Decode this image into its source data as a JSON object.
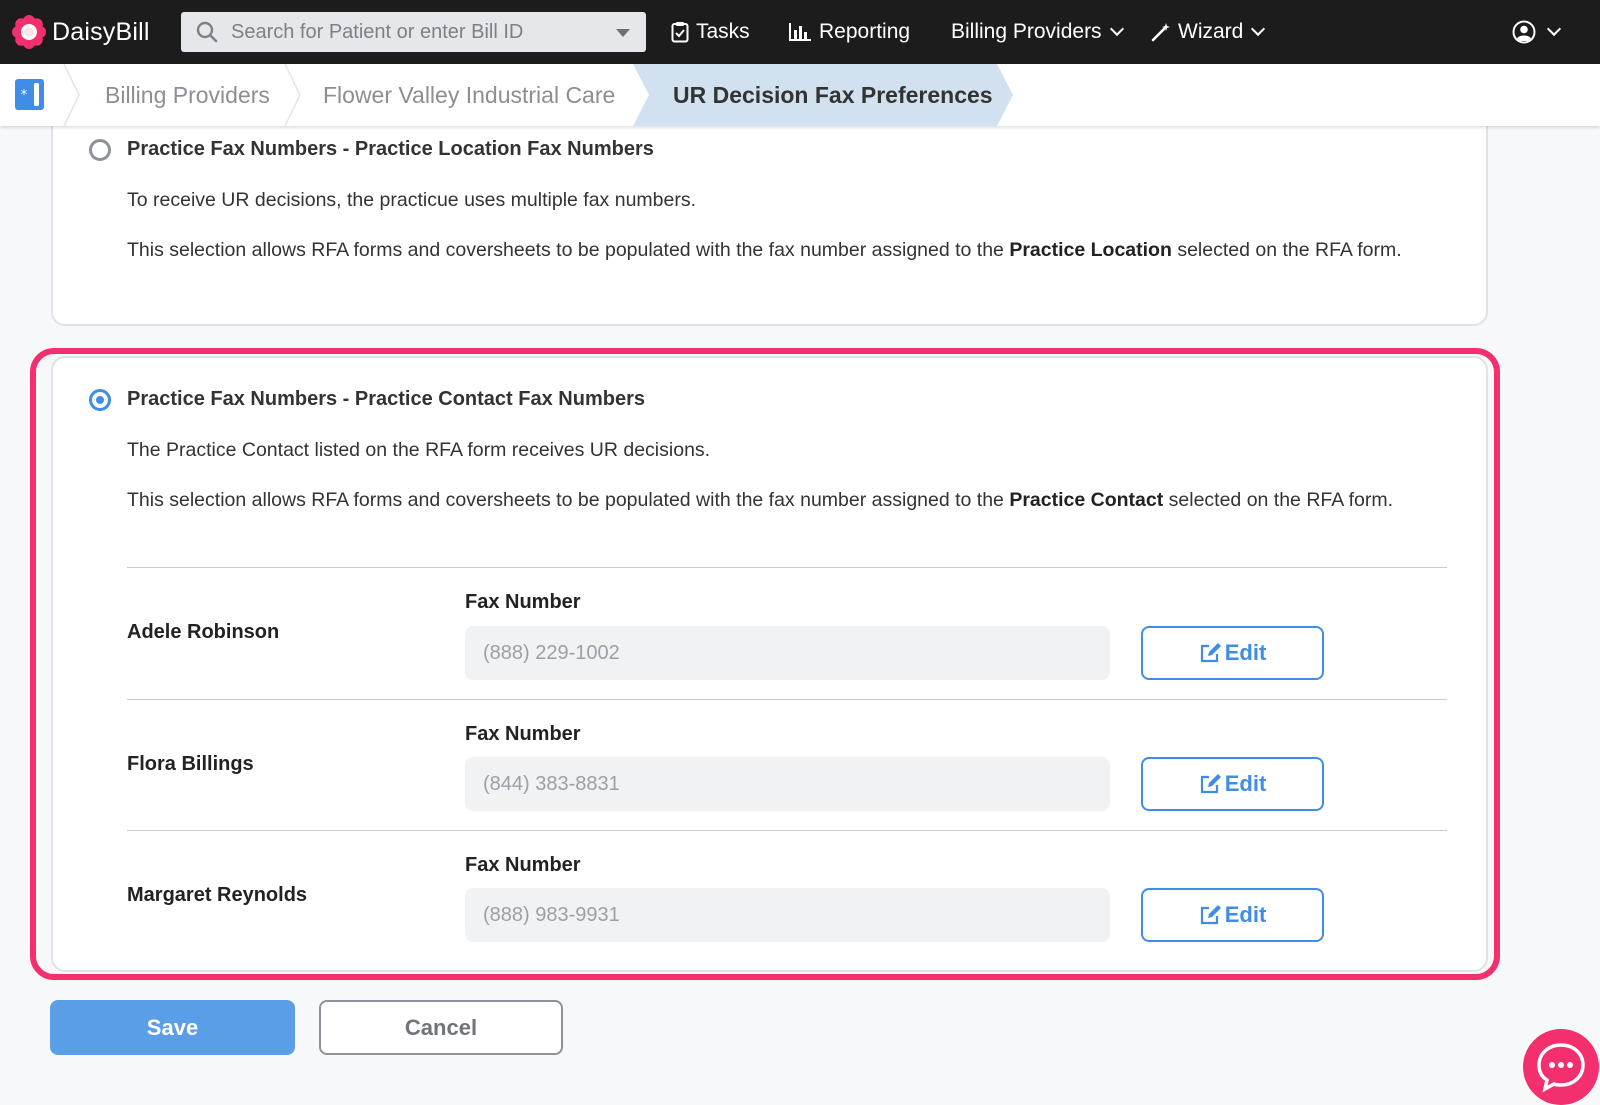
{
  "app": {
    "name": "DaisyBill"
  },
  "colors": {
    "accent": "#3f8de8",
    "highlight": "#f42f6d",
    "navbar": "#1c1c1c"
  },
  "navbar": {
    "search_placeholder": "Search for Patient or enter Bill ID",
    "items": [
      {
        "label": "Tasks",
        "icon": "clipboard-check-icon"
      },
      {
        "label": "Reporting",
        "icon": "bar-chart-icon"
      },
      {
        "label": "Billing Providers",
        "icon": "chevron-down-icon"
      },
      {
        "label": "Wizard",
        "icon": "magic-wand-icon"
      }
    ],
    "account_icon": "user-circle-icon"
  },
  "breadcrumb": {
    "items": [
      "Billing Providers",
      "Flower Valley Industrial Care"
    ],
    "current": "UR Decision Fax Preferences"
  },
  "options": [
    {
      "title": "Practice Fax Numbers - Practice Location Fax Numbers",
      "selected": false,
      "desc": "To receive UR decisions, the practicue uses multiple fax numbers.",
      "detail_pre": "This selection allows RFA forms and coversheets to be populated with the fax number assigned to the",
      "detail_bold": "Practice Location",
      "detail_post": "selected on the RFA form."
    },
    {
      "title": "Practice Fax Numbers - Practice Contact Fax Numbers",
      "selected": true,
      "desc": "The Practice Contact listed on the RFA form receives UR decisions.",
      "detail_pre": "This selection allows RFA forms and coversheets to be populated with the fax number assigned to the",
      "detail_bold": "Practice Contact",
      "detail_post": "selected on the RFA form."
    }
  ],
  "contacts": [
    {
      "name": "Adele Robinson",
      "fax_label": "Fax Number",
      "fax": "(888) 229-1002",
      "edit_label": "Edit"
    },
    {
      "name": "Flora Billings",
      "fax_label": "Fax Number",
      "fax": "(844) 383-8831",
      "edit_label": "Edit"
    },
    {
      "name": "Margaret Reynolds",
      "fax_label": "Fax Number",
      "fax": "(888) 983-9931",
      "edit_label": "Edit"
    }
  ],
  "actions": {
    "save_label": "Save",
    "cancel_label": "Cancel"
  },
  "chat": {
    "icon": "chat-bubble-icon"
  }
}
